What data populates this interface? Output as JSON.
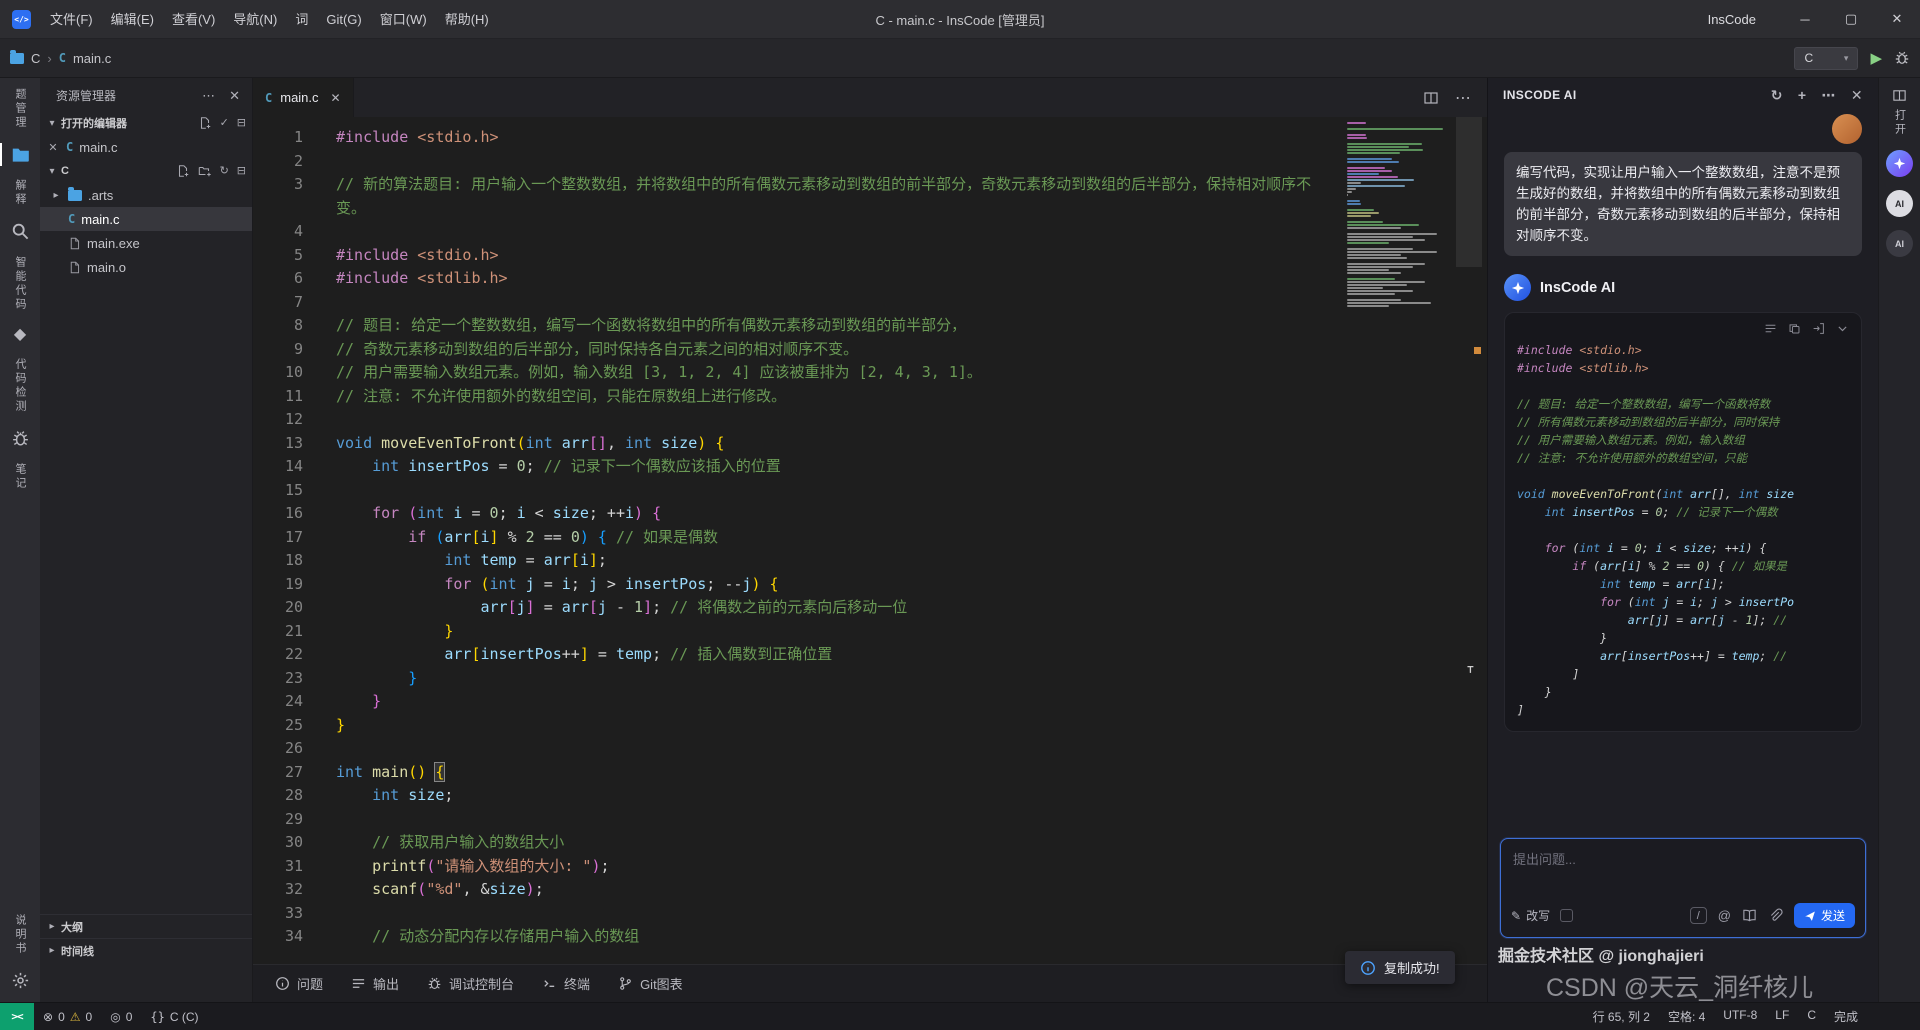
{
  "colors": {
    "accent": "#2468F2",
    "run_green": "#89D185",
    "remote_green": "#0DA06E",
    "error_red": "#F14C4C"
  },
  "titlebar": {
    "menus": [
      "文件(F)",
      "编辑(E)",
      "查看(V)",
      "导航(N)",
      "词",
      "Git(G)",
      "窗口(W)",
      "帮助(H)"
    ],
    "title": "C - main.c - InsCode [管理员]",
    "brand": "InsCode"
  },
  "toolbar": {
    "root": "C",
    "file": "main.c",
    "config": "C"
  },
  "activity": {
    "top": [
      {
        "kind": "text",
        "label": "题管理",
        "name": "question-bank"
      },
      {
        "kind": "icon",
        "icon": "folder",
        "name": "explorer",
        "active": true
      },
      {
        "kind": "text",
        "label": "解释",
        "name": "explain"
      },
      {
        "kind": "icon",
        "icon": "search",
        "name": "search"
      },
      {
        "kind": "text",
        "label": "智能代码",
        "name": "smart-code"
      },
      {
        "kind": "icon",
        "icon": "diamond",
        "name": "plugins"
      },
      {
        "kind": "text",
        "label": "代码检测",
        "name": "code-check"
      },
      {
        "kind": "icon",
        "icon": "bug",
        "name": "debug"
      },
      {
        "kind": "text",
        "label": "笔记",
        "name": "notes"
      }
    ],
    "bottom": [
      {
        "kind": "text",
        "label": "说明书",
        "name": "manual"
      },
      {
        "kind": "icon",
        "icon": "gear",
        "name": "settings"
      }
    ]
  },
  "sidebar": {
    "title": "资源管理器",
    "open_editors_label": "打开的编辑器",
    "open_files": [
      "main.c"
    ],
    "root": "C",
    "tree": [
      {
        "name": ".arts",
        "type": "folder"
      },
      {
        "name": "main.c",
        "type": "c",
        "selected": true
      },
      {
        "name": "main.exe",
        "type": "file"
      },
      {
        "name": "main.o",
        "type": "file"
      }
    ],
    "bottom_sections": [
      "大纲",
      "时间线"
    ]
  },
  "editor": {
    "tab": "main.c",
    "lines": [
      [
        [
          "d",
          "#include"
        ],
        [
          "p",
          " "
        ],
        [
          "s",
          "<stdio.h>"
        ]
      ],
      [],
      [
        [
          "c",
          "// 新的算法题目: 用户输入一个整数数组，并将数组中的所有偶数元素移动到数组的前半部分，奇数元素移动到数组的后半部分，保持相对顺序不变。"
        ]
      ],
      [],
      [
        [
          "d",
          "#include"
        ],
        [
          "p",
          " "
        ],
        [
          "s",
          "<stdio.h>"
        ]
      ],
      [
        [
          "d",
          "#include"
        ],
        [
          "p",
          " "
        ],
        [
          "s",
          "<stdlib.h>"
        ]
      ],
      [],
      [
        [
          "c",
          "// 题目: 给定一个整数数组，编写一个函数将数组中的所有偶数元素移动到数组的前半部分，"
        ]
      ],
      [
        [
          "c",
          "// 奇数元素移动到数组的后半部分，同时保持各自元素之间的相对顺序不变。"
        ]
      ],
      [
        [
          "c",
          "// 用户需要输入数组元素。例如，输入数组 [3, 1, 2, 4] 应该被重排为 [2, 4, 3, 1]。"
        ]
      ],
      [
        [
          "c",
          "// 注意: 不允许使用额外的数组空间，只能在原数组上进行修改。"
        ]
      ],
      [],
      [
        [
          "k",
          "void"
        ],
        [
          "p",
          " "
        ],
        [
          "f",
          "moveEvenToFront"
        ],
        [
          "b1",
          "("
        ],
        [
          "k",
          "int"
        ],
        [
          "p",
          " "
        ],
        [
          "v",
          "arr"
        ],
        [
          "b2",
          "[]"
        ],
        [
          "p",
          ", "
        ],
        [
          "k",
          "int"
        ],
        [
          "p",
          " "
        ],
        [
          "v",
          "size"
        ],
        [
          "b1",
          ")"
        ],
        [
          "p",
          " "
        ],
        [
          "b1",
          "{"
        ]
      ],
      [
        [
          "p",
          "    "
        ],
        [
          "k",
          "int"
        ],
        [
          "p",
          " "
        ],
        [
          "v",
          "insertPos"
        ],
        [
          "p",
          " = "
        ],
        [
          "n",
          "0"
        ],
        [
          "p",
          "; "
        ],
        [
          "c",
          "// 记录下一个偶数应该插入的位置"
        ]
      ],
      [],
      [
        [
          "p",
          "    "
        ],
        [
          "d",
          "for"
        ],
        [
          "p",
          " "
        ],
        [
          "b2",
          "("
        ],
        [
          "k",
          "int"
        ],
        [
          "p",
          " "
        ],
        [
          "v",
          "i"
        ],
        [
          "p",
          " = "
        ],
        [
          "n",
          "0"
        ],
        [
          "p",
          "; "
        ],
        [
          "v",
          "i"
        ],
        [
          "p",
          " < "
        ],
        [
          "v",
          "size"
        ],
        [
          "p",
          "; ++"
        ],
        [
          "v",
          "i"
        ],
        [
          "b2",
          ")"
        ],
        [
          "p",
          " "
        ],
        [
          "b2",
          "{"
        ]
      ],
      [
        [
          "p",
          "        "
        ],
        [
          "d",
          "if"
        ],
        [
          "p",
          " "
        ],
        [
          "b3",
          "("
        ],
        [
          "v",
          "arr"
        ],
        [
          "b1",
          "["
        ],
        [
          "v",
          "i"
        ],
        [
          "b1",
          "]"
        ],
        [
          "p",
          " % "
        ],
        [
          "n",
          "2"
        ],
        [
          "p",
          " == "
        ],
        [
          "n",
          "0"
        ],
        [
          "b3",
          ")"
        ],
        [
          "p",
          " "
        ],
        [
          "b3",
          "{"
        ],
        [
          "p",
          " "
        ],
        [
          "c",
          "// 如果是偶数"
        ]
      ],
      [
        [
          "p",
          "            "
        ],
        [
          "k",
          "int"
        ],
        [
          "p",
          " "
        ],
        [
          "v",
          "temp"
        ],
        [
          "p",
          " = "
        ],
        [
          "v",
          "arr"
        ],
        [
          "b1",
          "["
        ],
        [
          "v",
          "i"
        ],
        [
          "b1",
          "]"
        ],
        [
          "p",
          ";"
        ]
      ],
      [
        [
          "p",
          "            "
        ],
        [
          "d",
          "for"
        ],
        [
          "p",
          " "
        ],
        [
          "b1",
          "("
        ],
        [
          "k",
          "int"
        ],
        [
          "p",
          " "
        ],
        [
          "v",
          "j"
        ],
        [
          "p",
          " = "
        ],
        [
          "v",
          "i"
        ],
        [
          "p",
          "; "
        ],
        [
          "v",
          "j"
        ],
        [
          "p",
          " > "
        ],
        [
          "v",
          "insertPos"
        ],
        [
          "p",
          "; --"
        ],
        [
          "v",
          "j"
        ],
        [
          "b1",
          ")"
        ],
        [
          "p",
          " "
        ],
        [
          "b1",
          "{"
        ]
      ],
      [
        [
          "p",
          "                "
        ],
        [
          "v",
          "arr"
        ],
        [
          "b2",
          "["
        ],
        [
          "v",
          "j"
        ],
        [
          "b2",
          "]"
        ],
        [
          "p",
          " = "
        ],
        [
          "v",
          "arr"
        ],
        [
          "b2",
          "["
        ],
        [
          "v",
          "j"
        ],
        [
          "p",
          " - "
        ],
        [
          "n",
          "1"
        ],
        [
          "b2",
          "]"
        ],
        [
          "p",
          "; "
        ],
        [
          "c",
          "// 将偶数之前的元素向后移动一位"
        ]
      ],
      [
        [
          "p",
          "            "
        ],
        [
          "b1",
          "}"
        ]
      ],
      [
        [
          "p",
          "            "
        ],
        [
          "v",
          "arr"
        ],
        [
          "b1",
          "["
        ],
        [
          "v",
          "insertPos"
        ],
        [
          "p",
          "++"
        ],
        [
          "b1",
          "]"
        ],
        [
          "p",
          " = "
        ],
        [
          "v",
          "temp"
        ],
        [
          "p",
          "; "
        ],
        [
          "c",
          "// 插入偶数到正确位置"
        ]
      ],
      [
        [
          "p",
          "        "
        ],
        [
          "b3",
          "}"
        ]
      ],
      [
        [
          "p",
          "    "
        ],
        [
          "b2",
          "}"
        ]
      ],
      [
        [
          "b1",
          "}"
        ]
      ],
      [],
      [
        [
          "k",
          "int"
        ],
        [
          "p",
          " "
        ],
        [
          "f",
          "main"
        ],
        [
          "b1",
          "()"
        ],
        [
          "p",
          " "
        ],
        [
          "bm",
          "{"
        ]
      ],
      [
        [
          "p",
          "    "
        ],
        [
          "k",
          "int"
        ],
        [
          "p",
          " "
        ],
        [
          "v",
          "size"
        ],
        [
          "p",
          ";"
        ]
      ],
      [],
      [
        [
          "p",
          "    "
        ],
        [
          "c",
          "// 获取用户输入的数组大小"
        ]
      ],
      [
        [
          "p",
          "    "
        ],
        [
          "f",
          "printf"
        ],
        [
          "b2",
          "("
        ],
        [
          "s",
          "\"请输入数组的大小: \""
        ],
        [
          "b2",
          ")"
        ],
        [
          "p",
          ";"
        ]
      ],
      [
        [
          "p",
          "    "
        ],
        [
          "f",
          "scanf"
        ],
        [
          "b2",
          "("
        ],
        [
          "s",
          "\"%d\""
        ],
        [
          "p",
          ", &"
        ],
        [
          "v",
          "size"
        ],
        [
          "b2",
          ")"
        ],
        [
          "p",
          ";"
        ]
      ],
      [],
      [
        [
          "p",
          "    "
        ],
        [
          "c",
          "// 动态分配内存以存储用户输入的数组"
        ]
      ]
    ]
  },
  "panel": {
    "tabs": [
      {
        "icon": "info",
        "label": "问题",
        "name": "problems"
      },
      {
        "icon": "lines",
        "label": "输出",
        "name": "output"
      },
      {
        "icon": "bug",
        "label": "调试控制台",
        "name": "debug-console"
      },
      {
        "icon": "terminal",
        "label": "终端",
        "name": "terminal"
      },
      {
        "icon": "branch",
        "label": "Git图表",
        "name": "git-graph"
      }
    ]
  },
  "status": {
    "errors": "0",
    "warnings": "0",
    "badge": "0",
    "lang": "C (C)",
    "right": [
      "行 65, 列 2",
      "空格: 4",
      "UTF-8",
      "LF",
      "C",
      "完成"
    ]
  },
  "ai": {
    "title": "INSCODE AI",
    "user_message": "编写代码，实现让用户输入一个整数数组，注意不是预生成好的数组，并将数组中的所有偶数元素移动到数组的前半部分，奇数元素移动到数组的后半部分，保持相对顺序不变。",
    "assistant": "InsCode AI",
    "placeholder": "提出问题...",
    "rewrite": "改写",
    "send": "发送",
    "code_lines": [
      [
        [
          "d",
          "#include"
        ],
        [
          "p",
          " "
        ],
        [
          "s",
          "<stdio.h>"
        ]
      ],
      [
        [
          "d",
          "#include"
        ],
        [
          "p",
          " "
        ],
        [
          "s",
          "<stdlib.h>"
        ]
      ],
      [],
      [
        [
          "c",
          "// 题目: 给定一个整数数组，编写一个函数将数"
        ]
      ],
      [
        [
          "c",
          "// 所有偶数元素移动到数组的后半部分，同时保持"
        ]
      ],
      [
        [
          "c",
          "// 用户需要输入数组元素。例如，输入数组"
        ]
      ],
      [
        [
          "c",
          "// 注意: 不允许使用额外的数组空间，只能"
        ]
      ],
      [],
      [
        [
          "k",
          "void"
        ],
        [
          "p",
          " "
        ],
        [
          "f",
          "moveEvenToFront"
        ],
        [
          "p",
          "("
        ],
        [
          "k",
          "int"
        ],
        [
          "p",
          " "
        ],
        [
          "v",
          "arr"
        ],
        [
          "p",
          "[], "
        ],
        [
          "k",
          "int"
        ],
        [
          "p",
          " "
        ],
        [
          "v",
          "size"
        ]
      ],
      [
        [
          "p",
          "    "
        ],
        [
          "k",
          "int"
        ],
        [
          "p",
          " "
        ],
        [
          "v",
          "insertPos"
        ],
        [
          "p",
          " = "
        ],
        [
          "n",
          "0"
        ],
        [
          "p",
          "; "
        ],
        [
          "c",
          "// 记录下一个偶数"
        ]
      ],
      [],
      [
        [
          "p",
          "    "
        ],
        [
          "d",
          "for"
        ],
        [
          "p",
          " ("
        ],
        [
          "k",
          "int"
        ],
        [
          "p",
          " "
        ],
        [
          "v",
          "i"
        ],
        [
          "p",
          " = "
        ],
        [
          "n",
          "0"
        ],
        [
          "p",
          "; "
        ],
        [
          "v",
          "i"
        ],
        [
          "p",
          " < "
        ],
        [
          "v",
          "size"
        ],
        [
          "p",
          "; ++"
        ],
        [
          "v",
          "i"
        ],
        [
          "p",
          ") {"
        ]
      ],
      [
        [
          "p",
          "        "
        ],
        [
          "d",
          "if"
        ],
        [
          "p",
          " ("
        ],
        [
          "v",
          "arr"
        ],
        [
          "p",
          "["
        ],
        [
          "v",
          "i"
        ],
        [
          "p",
          "] % "
        ],
        [
          "n",
          "2"
        ],
        [
          "p",
          " == "
        ],
        [
          "n",
          "0"
        ],
        [
          "p",
          ") { "
        ],
        [
          "c",
          "// 如果是"
        ]
      ],
      [
        [
          "p",
          "            "
        ],
        [
          "k",
          "int"
        ],
        [
          "p",
          " "
        ],
        [
          "v",
          "temp"
        ],
        [
          "p",
          " = "
        ],
        [
          "v",
          "arr"
        ],
        [
          "p",
          "["
        ],
        [
          "v",
          "i"
        ],
        [
          "p",
          "];"
        ]
      ],
      [
        [
          "p",
          "            "
        ],
        [
          "d",
          "for"
        ],
        [
          "p",
          " ("
        ],
        [
          "k",
          "int"
        ],
        [
          "p",
          " "
        ],
        [
          "v",
          "j"
        ],
        [
          "p",
          " = "
        ],
        [
          "v",
          "i"
        ],
        [
          "p",
          "; "
        ],
        [
          "v",
          "j"
        ],
        [
          "p",
          " > "
        ],
        [
          "v",
          "insertPo"
        ]
      ],
      [
        [
          "p",
          "                "
        ],
        [
          "v",
          "arr"
        ],
        [
          "p",
          "["
        ],
        [
          "v",
          "j"
        ],
        [
          "p",
          "] = "
        ],
        [
          "v",
          "arr"
        ],
        [
          "p",
          "["
        ],
        [
          "v",
          "j"
        ],
        [
          "p",
          " - "
        ],
        [
          "n",
          "1"
        ],
        [
          "p",
          "]; "
        ],
        [
          "c",
          "//"
        ]
      ],
      [
        [
          "p",
          "            }"
        ]
      ],
      [
        [
          "p",
          "            "
        ],
        [
          "v",
          "arr"
        ],
        [
          "p",
          "["
        ],
        [
          "v",
          "insertPos"
        ],
        [
          "p",
          "++] = "
        ],
        [
          "v",
          "temp"
        ],
        [
          "p",
          "; "
        ],
        [
          "c",
          "//"
        ]
      ],
      [
        [
          "p",
          "        ]"
        ]
      ],
      [
        [
          "p",
          "    }"
        ]
      ],
      [
        [
          "p",
          "]"
        ]
      ]
    ]
  },
  "rightstrip": {
    "label": "打开",
    "badge": "AI"
  },
  "toast": {
    "text": "复制成功!"
  },
  "watermarks": {
    "jj": "掘金技术社区 @ jionghajieri",
    "csdn": "CSDN @天云_洞纤核儿"
  }
}
